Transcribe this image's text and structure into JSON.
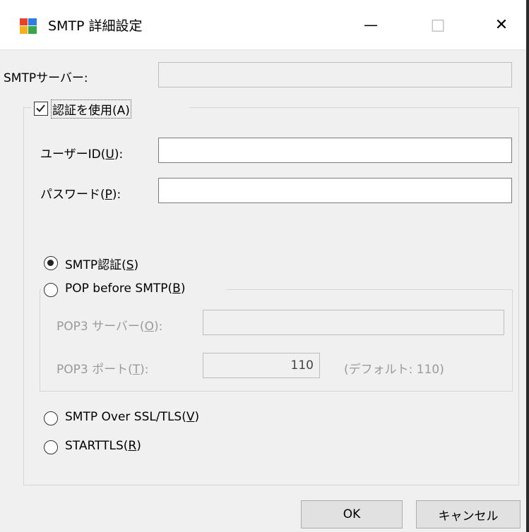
{
  "window": {
    "title": "SMTP 詳細設定",
    "minimize_label": "—",
    "maximize_label": "□",
    "close_label": "✕"
  },
  "smtp_server": {
    "label": "SMTPサーバー:",
    "value": ""
  },
  "auth": {
    "checkbox_label": "認証を使用(A)",
    "checked": true,
    "user_id": {
      "label_pre": "ユーザーID(",
      "label_key": "U",
      "label_post": "):",
      "value": ""
    },
    "password": {
      "label_pre": "パスワード(",
      "label_key": "P",
      "label_post": "):",
      "value": ""
    },
    "methods": {
      "smtp_auth": {
        "pre": "SMTP認証(",
        "key": "S",
        "post": ")",
        "selected": true
      },
      "pop_before_smtp": {
        "pre": "POP before SMTP(",
        "key": "B",
        "post": ")",
        "selected": false
      },
      "smtp_over_ssl": {
        "pre": "SMTP Over SSL/TLS(",
        "key": "V",
        "post": ")",
        "selected": false
      },
      "starttls": {
        "pre": "STARTTLS(",
        "key": "R",
        "post": ")",
        "selected": false
      }
    },
    "pop3": {
      "server": {
        "label_pre": "POP3 サーバー(",
        "label_key": "O",
        "label_post": "):",
        "value": ""
      },
      "port": {
        "label_pre": "POP3 ポート(",
        "label_key": "T",
        "label_post": "):",
        "value": "110",
        "default_note": "(デフォルト: 110)"
      }
    }
  },
  "buttons": {
    "ok": "OK",
    "cancel": "キャンセル"
  }
}
